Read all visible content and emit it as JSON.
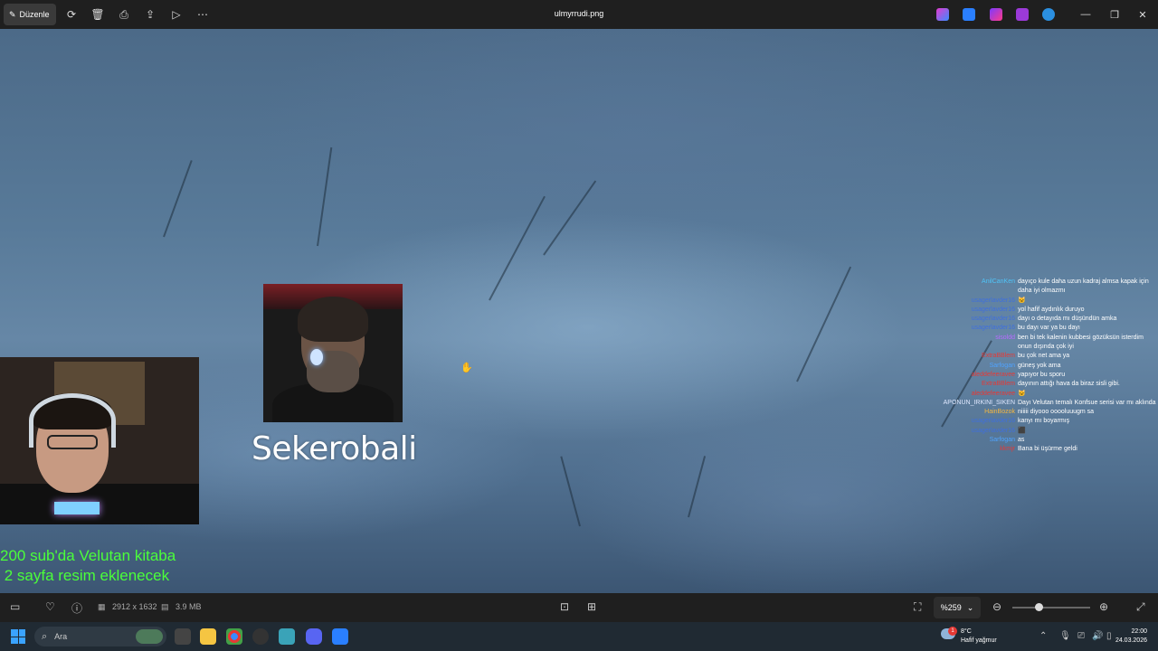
{
  "titlebar": {
    "edit_label": "Düzenle",
    "filename": "ulmyrrudi.png",
    "minimize": "—",
    "maximize": "❐",
    "close": "✕"
  },
  "overlay": {
    "webcam_name": "Sekerobali",
    "sub_goal_line1": "200 sub'da Velutan kitaba",
    "sub_goal_line2": " 2 sayfa resim eklenecek"
  },
  "chat": [
    {
      "user": "AnilCanKen",
      "user_color": "#4fc3f7",
      "msg": "dayıço kule daha uzun kadraj almsa kapak için daha iyi olmazmı"
    },
    {
      "user": "usagerlavder16",
      "user_color": "#3f6fdd",
      "msg": "🐱"
    },
    {
      "user": "usagerlavder16",
      "user_color": "#3f6fdd",
      "msg": "yol hafif aydınlık duruyo"
    },
    {
      "user": "usagerlavder16",
      "user_color": "#3f6fdd",
      "msg": "dayı o detayıda mı düşündün amka"
    },
    {
      "user": "usagerlavder16",
      "user_color": "#3f6fdd",
      "msg": "bu dayı var ya bu dayı"
    },
    {
      "user": "sisoldd",
      "user_color": "#b86bff",
      "msg": "ben bi tek kalenin kubbesi gözüksün isterdim onun dışında çok iyi"
    },
    {
      "user": "ExtraBBlem",
      "user_color": "#e53935",
      "msg": "bu çok net ama ya"
    },
    {
      "user": "Sarfogan",
      "user_color": "#4fa3ff",
      "msg": "güneş yok ama"
    },
    {
      "user": "aleddefeeravee",
      "user_color": "#e53935",
      "msg": "yapıyor bu sporu"
    },
    {
      "user": "ExtraBBlem",
      "user_color": "#e53935",
      "msg": "dayının attığı hava da biraz sisli gibi."
    },
    {
      "user": "aleddefeeravee",
      "user_color": "#e53935",
      "msg": "🐱"
    },
    {
      "user": "APONUN_IRKINI_SIKEN",
      "user_color": "#dfe8ff",
      "msg": "Dayı Velutan temalı Konfsue serisi var mı aklında"
    },
    {
      "user": "HainBozok",
      "user_color": "#f5b740",
      "msg": "niiiii diyooo ooooluuugm sa"
    },
    {
      "user": "usagerlavder16",
      "user_color": "#3f6fdd",
      "msg": "kanyı mı boyarmış"
    },
    {
      "user": "usagerlavder16",
      "user_color": "#3f6fdd",
      "msg": "⬛"
    },
    {
      "user": "Sarfogan",
      "user_color": "#4fa3ff",
      "msg": "as"
    },
    {
      "user": "kkmjr",
      "user_color": "#e53935",
      "msg": "Bana bi üşürme geldi"
    }
  ],
  "bottombar": {
    "dimensions": "2912 x 1632",
    "filesize": "3.9 MB",
    "zoom": "%259"
  },
  "taskbar": {
    "search_label": "Ara",
    "weather_temp": "8°C",
    "weather_desc": "Hafif yağmur",
    "weather_badge": "1",
    "time": "22:00",
    "date": "24.03.2026"
  },
  "colors": {
    "accent_green": "#4bff3a",
    "windows_blue": "#3aa3ff"
  }
}
